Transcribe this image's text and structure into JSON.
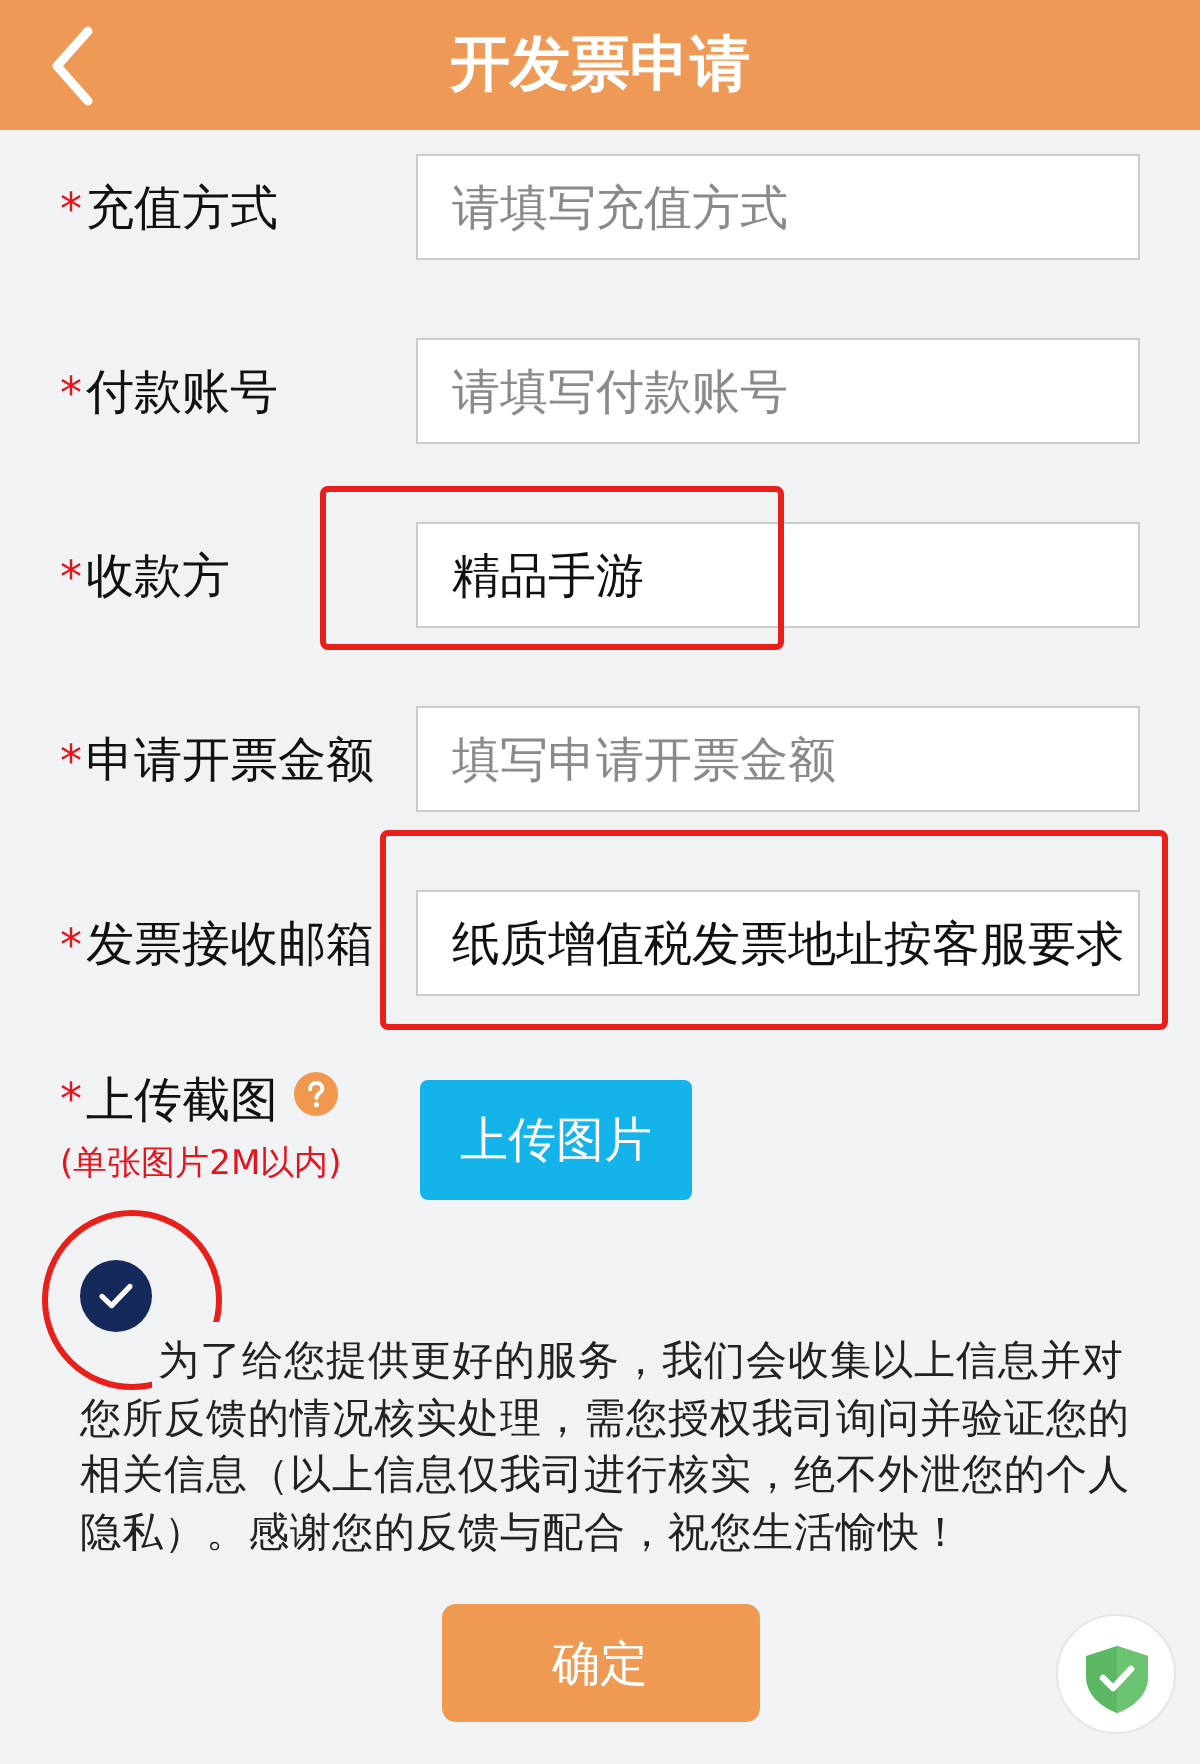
{
  "header": {
    "title": "开发票申请"
  },
  "fields": [
    {
      "required_mark": "*",
      "label": "充值方式",
      "placeholder": "请填写充值方式",
      "highlighted": false
    },
    {
      "required_mark": "*",
      "label": "付款账号",
      "placeholder": "请填写付款账号",
      "highlighted": false
    },
    {
      "required_mark": "*",
      "label": "收款方",
      "value": "精品手游",
      "highlighted": true
    },
    {
      "required_mark": "*",
      "label": "申请开票金额",
      "placeholder": "填写申请开票金额",
      "highlighted": false
    },
    {
      "required_mark": "*",
      "label": "发票接收邮箱",
      "value": "纸质增值税发票地址按客服要求",
      "highlighted": true
    }
  ],
  "upload": {
    "required_mark": "*",
    "label": "上传截图",
    "hint": "(单张图片2M以内)",
    "button": "上传图片"
  },
  "agreement": {
    "checked": true,
    "highlighted": true,
    "text": "为了给您提供更好的服务，我们会收集以上信息并对您所反馈的情况核实处理，需您授权我司询问并验证您的相关信息（以上信息仅我司进行核实，绝不外泄您的个人隐私）。感谢您的反馈与配合，祝您生活愉快！"
  },
  "submit_button": "确定"
}
